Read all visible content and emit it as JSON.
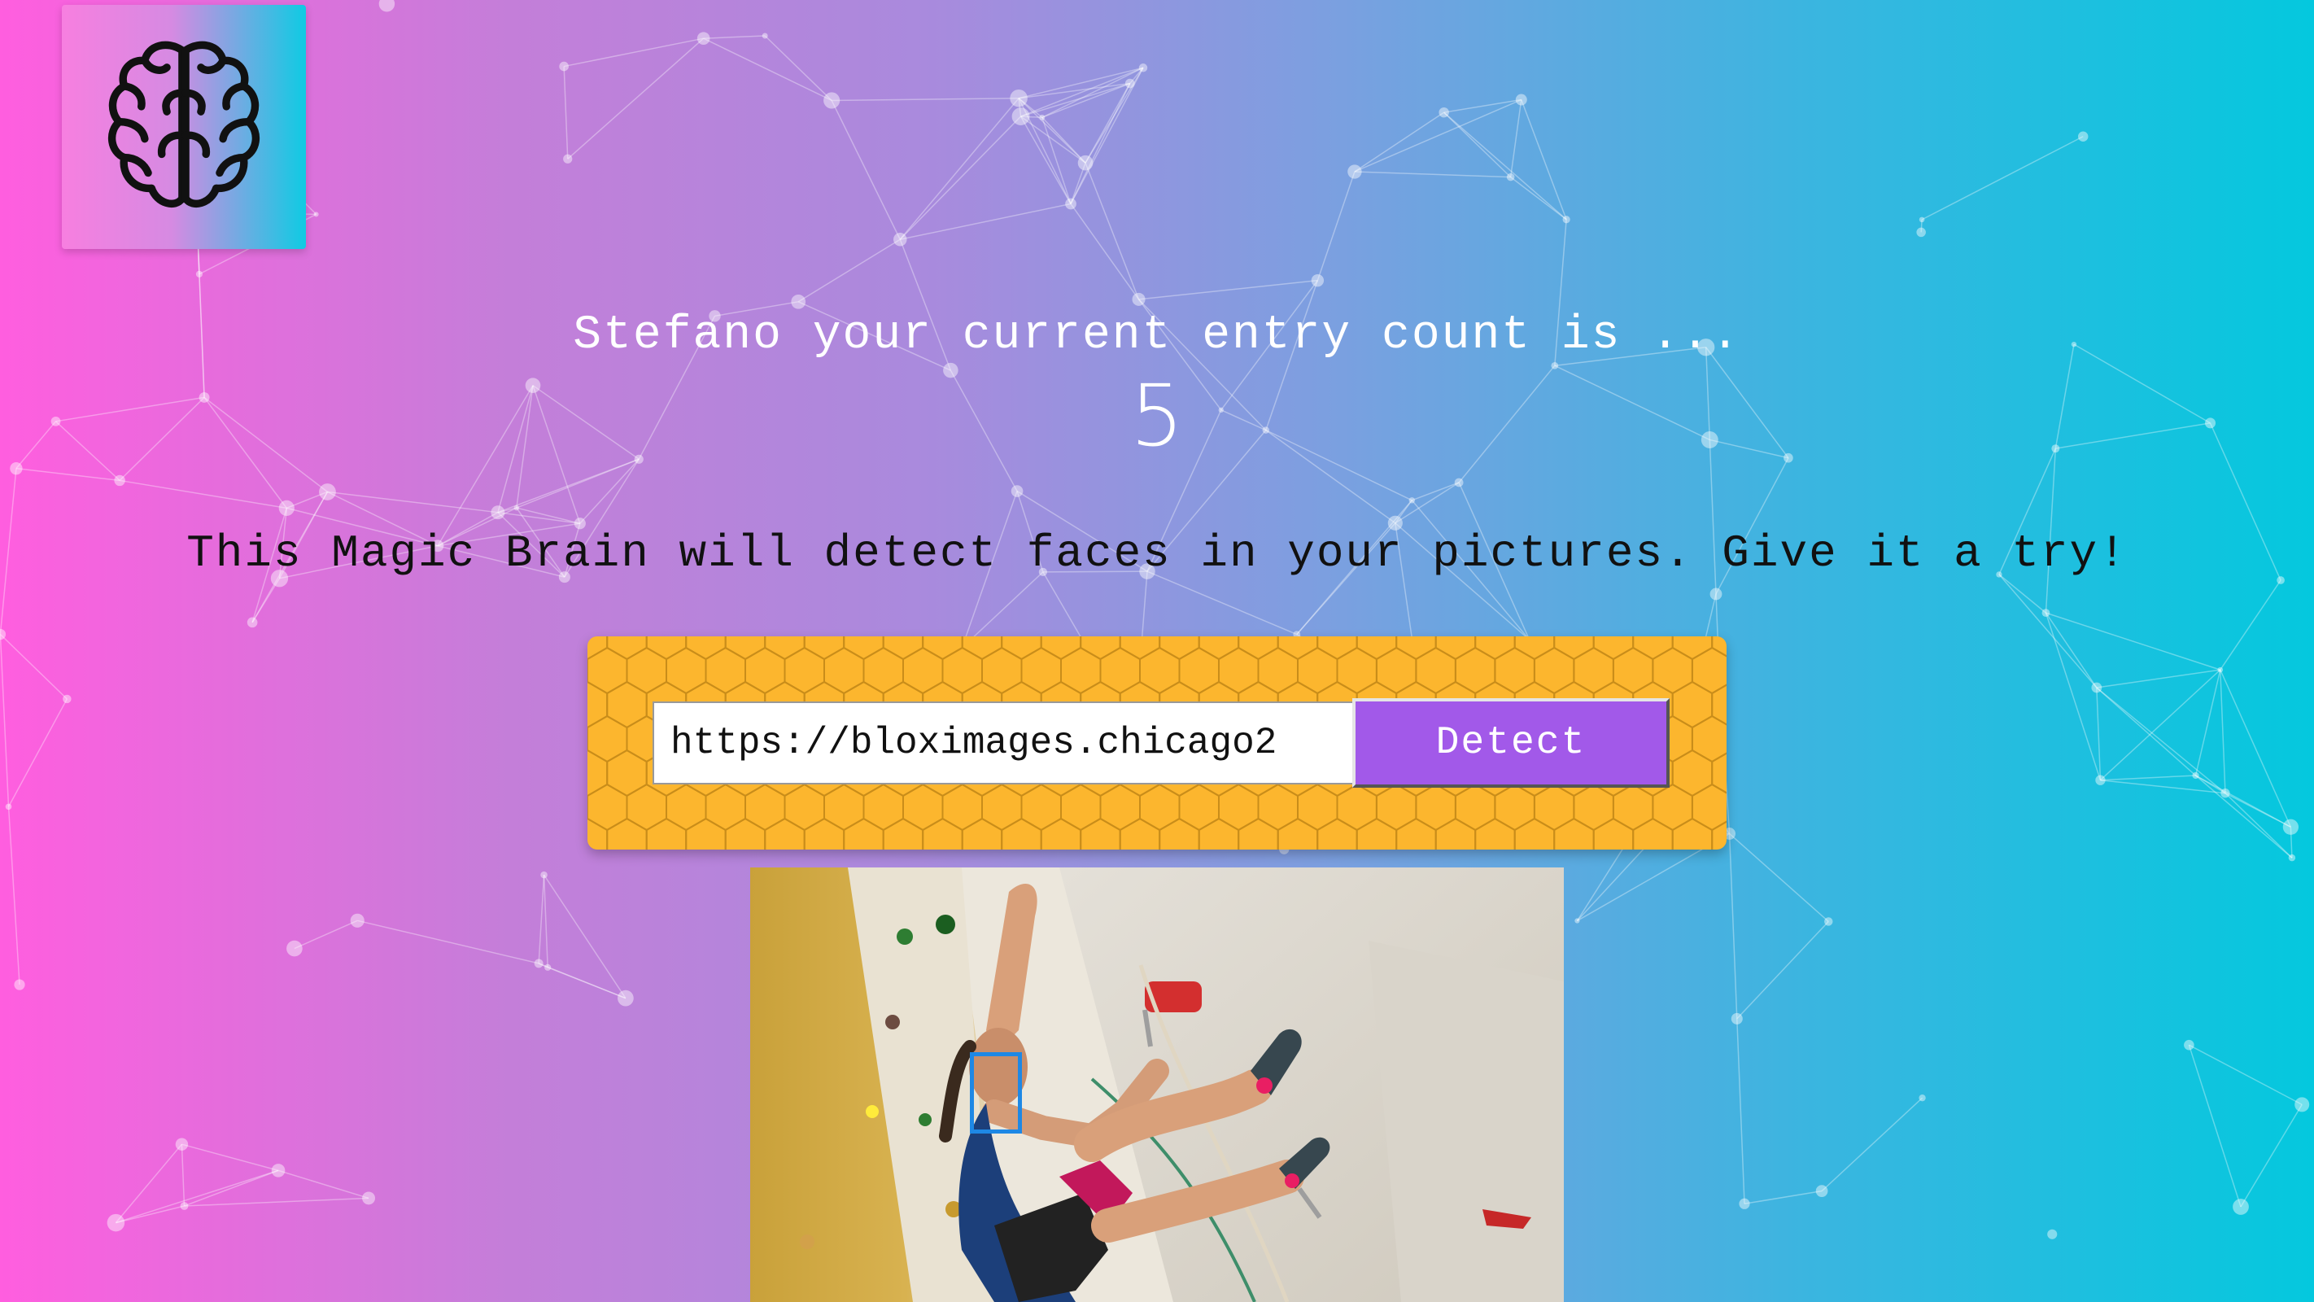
{
  "app": {
    "logo": {
      "icon": "brain-icon"
    }
  },
  "greeting": {
    "entry_text": "Stefano your current entry count is ...",
    "entry_count": "5"
  },
  "tagline": "This Magic Brain will detect faces in your pictures. Give it a try!",
  "form": {
    "url_value": "https://bloximages.chicago2",
    "detect_label": "Detect"
  },
  "result_image": {
    "faces_detected": 1
  },
  "colors": {
    "gradient_left": "#ff5edf",
    "gradient_right": "#04c8de",
    "panel": "#fcb62e",
    "button": "#a259e9",
    "face_box": "#1e88e5"
  }
}
